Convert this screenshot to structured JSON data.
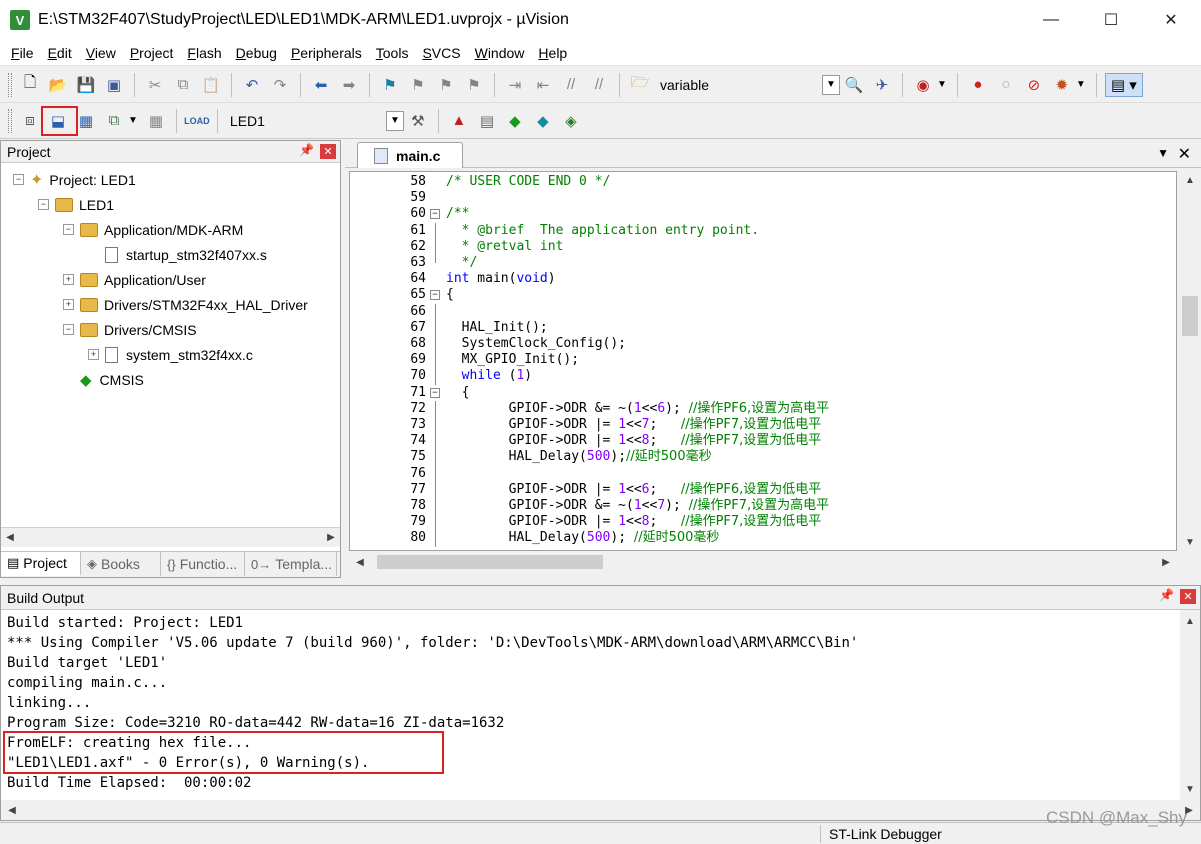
{
  "window": {
    "title": "E:\\STM32F407\\StudyProject\\LED\\LED1\\MDK-ARM\\LED1.uvprojx - µVision",
    "app_icon": "V",
    "minimize": "—",
    "maximize": "☐",
    "close": "✕"
  },
  "menu": [
    {
      "first": "F",
      "rest": "ile"
    },
    {
      "first": "E",
      "rest": "dit"
    },
    {
      "first": "V",
      "rest": "iew"
    },
    {
      "first": "P",
      "rest": "roject"
    },
    {
      "first": "F",
      "rest": "lash",
      "pre": ""
    },
    {
      "first": "D",
      "rest": "ebug"
    },
    {
      "first": "P",
      "rest": "eripherals"
    },
    {
      "first": "T",
      "rest": "ools"
    },
    {
      "first": "S",
      "rest": "VCS"
    },
    {
      "first": "W",
      "rest": "indow"
    },
    {
      "first": "H",
      "rest": "elp"
    }
  ],
  "toolbar": {
    "find_text": "variable",
    "target": "LED1",
    "icons": {
      "new": "new-file-icon",
      "open": "open-folder-icon",
      "save": "save-icon",
      "save_all": "save-all-icon",
      "cut": "cut-icon",
      "copy": "copy-icon",
      "paste": "paste-icon",
      "undo": "undo-icon",
      "redo": "redo-icon",
      "back": "nav-back-icon",
      "forward": "nav-forward-icon",
      "bookmark": "bookmark-icon",
      "build": "build-icon",
      "rebuild": "rebuild-icon",
      "download": "download-load-icon"
    }
  },
  "project_panel": {
    "title": "Project",
    "tree": [
      {
        "label": "Project: LED1",
        "level": 0,
        "exp": "−",
        "kind": "project"
      },
      {
        "label": "LED1",
        "level": 1,
        "exp": "−",
        "kind": "target"
      },
      {
        "label": "Application/MDK-ARM",
        "level": 2,
        "exp": "−",
        "kind": "folder"
      },
      {
        "label": "startup_stm32f407xx.s",
        "level": 3,
        "exp": "",
        "kind": "file"
      },
      {
        "label": "Application/User",
        "level": 2,
        "exp": "+",
        "kind": "folder"
      },
      {
        "label": "Drivers/STM32F4xx_HAL_Driver",
        "level": 2,
        "exp": "+",
        "kind": "folder"
      },
      {
        "label": "Drivers/CMSIS",
        "level": 2,
        "exp": "−",
        "kind": "folder"
      },
      {
        "label": "system_stm32f4xx.c",
        "level": 3,
        "exp": "+",
        "kind": "file"
      },
      {
        "label": "CMSIS",
        "level": 2,
        "exp": "",
        "kind": "cmsis"
      }
    ],
    "tabs": [
      {
        "label": "Project",
        "icon": "▤"
      },
      {
        "label": "Books",
        "icon": "◈"
      },
      {
        "label": "Functio...",
        "icon": "{}"
      },
      {
        "label": "Templa...",
        "icon": "0→"
      }
    ]
  },
  "editor": {
    "tab": "main.c",
    "lines": [
      {
        "n": "58",
        "fold": "",
        "parts": [
          {
            "c": "c-comment",
            "t": "/* USER CODE END 0 */"
          }
        ]
      },
      {
        "n": "59",
        "fold": "",
        "parts": []
      },
      {
        "n": "60",
        "fold": "−",
        "parts": [
          {
            "c": "c-comment",
            "t": "/**"
          }
        ]
      },
      {
        "n": "61",
        "fold": "|",
        "parts": [
          {
            "c": "c-comment",
            "t": "  * @brief  The application entry point."
          }
        ]
      },
      {
        "n": "62",
        "fold": "|",
        "parts": [
          {
            "c": "c-comment",
            "t": "  * @retval int"
          }
        ]
      },
      {
        "n": "63",
        "fold": "L",
        "parts": [
          {
            "c": "c-comment",
            "t": "  */"
          }
        ]
      },
      {
        "n": "64",
        "fold": "",
        "parts": [
          {
            "c": "c-kw",
            "t": "int"
          },
          {
            "c": "",
            "t": " main("
          },
          {
            "c": "c-kw",
            "t": "void"
          },
          {
            "c": "",
            "t": ")"
          }
        ]
      },
      {
        "n": "65",
        "fold": "−",
        "parts": [
          {
            "c": "",
            "t": "{"
          }
        ]
      },
      {
        "n": "66",
        "fold": "|",
        "parts": []
      },
      {
        "n": "67",
        "fold": "|",
        "parts": [
          {
            "c": "",
            "t": "  HAL_Init();"
          }
        ]
      },
      {
        "n": "68",
        "fold": "|",
        "parts": [
          {
            "c": "",
            "t": "  SystemClock_Config();"
          }
        ]
      },
      {
        "n": "69",
        "fold": "|",
        "parts": [
          {
            "c": "",
            "t": "  MX_GPIO_Init();"
          }
        ]
      },
      {
        "n": "70",
        "fold": "|",
        "parts": [
          {
            "c": "",
            "t": "  "
          },
          {
            "c": "c-kw",
            "t": "while"
          },
          {
            "c": "",
            "t": " ("
          },
          {
            "c": "c-num",
            "t": "1"
          },
          {
            "c": "",
            "t": ")"
          }
        ]
      },
      {
        "n": "71",
        "fold": "−",
        "parts": [
          {
            "c": "",
            "t": "  {"
          }
        ]
      },
      {
        "n": "72",
        "fold": "|",
        "parts": [
          {
            "c": "",
            "t": "        GPIOF->ODR &= ~("
          },
          {
            "c": "c-num",
            "t": "1"
          },
          {
            "c": "",
            "t": "<<"
          },
          {
            "c": "c-num",
            "t": "6"
          },
          {
            "c": "",
            "t": "); "
          },
          {
            "c": "c-cn",
            "t": "//操作PF6,设置为高电平"
          }
        ]
      },
      {
        "n": "73",
        "fold": "|",
        "parts": [
          {
            "c": "",
            "t": "        GPIOF->ODR |= "
          },
          {
            "c": "c-num",
            "t": "1"
          },
          {
            "c": "",
            "t": "<<"
          },
          {
            "c": "c-num",
            "t": "7"
          },
          {
            "c": "",
            "t": ";   "
          },
          {
            "c": "c-cn",
            "t": "//操作PF7,设置为低电平"
          }
        ]
      },
      {
        "n": "74",
        "fold": "|",
        "parts": [
          {
            "c": "",
            "t": "        GPIOF->ODR |= "
          },
          {
            "c": "c-num",
            "t": "1"
          },
          {
            "c": "",
            "t": "<<"
          },
          {
            "c": "c-num",
            "t": "8"
          },
          {
            "c": "",
            "t": ";   "
          },
          {
            "c": "c-cn",
            "t": "//操作PF7,设置为低电平"
          }
        ]
      },
      {
        "n": "75",
        "fold": "|",
        "parts": [
          {
            "c": "",
            "t": "        HAL_Delay("
          },
          {
            "c": "c-num",
            "t": "500"
          },
          {
            "c": "",
            "t": ");"
          },
          {
            "c": "c-cn",
            "t": "//延时500毫秒"
          }
        ]
      },
      {
        "n": "76",
        "fold": "|",
        "parts": []
      },
      {
        "n": "77",
        "fold": "|",
        "parts": [
          {
            "c": "",
            "t": "        GPIOF->ODR |= "
          },
          {
            "c": "c-num",
            "t": "1"
          },
          {
            "c": "",
            "t": "<<"
          },
          {
            "c": "c-num",
            "t": "6"
          },
          {
            "c": "",
            "t": ";   "
          },
          {
            "c": "c-cn",
            "t": "//操作PF6,设置为低电平"
          }
        ]
      },
      {
        "n": "78",
        "fold": "|",
        "parts": [
          {
            "c": "",
            "t": "        GPIOF->ODR &= ~("
          },
          {
            "c": "c-num",
            "t": "1"
          },
          {
            "c": "",
            "t": "<<"
          },
          {
            "c": "c-num",
            "t": "7"
          },
          {
            "c": "",
            "t": "); "
          },
          {
            "c": "c-cn",
            "t": "//操作PF7,设置为高电平"
          }
        ]
      },
      {
        "n": "79",
        "fold": "|",
        "parts": [
          {
            "c": "",
            "t": "        GPIOF->ODR |= "
          },
          {
            "c": "c-num",
            "t": "1"
          },
          {
            "c": "",
            "t": "<<"
          },
          {
            "c": "c-num",
            "t": "8"
          },
          {
            "c": "",
            "t": ";   "
          },
          {
            "c": "c-cn",
            "t": "//操作PF7,设置为低电平"
          }
        ]
      },
      {
        "n": "80",
        "fold": "|",
        "parts": [
          {
            "c": "",
            "t": "        HAL_Delay("
          },
          {
            "c": "c-num",
            "t": "500"
          },
          {
            "c": "",
            "t": "); "
          },
          {
            "c": "c-cn",
            "t": "//延时500毫秒"
          }
        ]
      }
    ]
  },
  "build_output": {
    "title": "Build Output",
    "lines": [
      "Build started: Project: LED1",
      "*** Using Compiler 'V5.06 update 7 (build 960)', folder: 'D:\\DevTools\\MDK-ARM\\download\\ARM\\ARMCC\\Bin'",
      "Build target 'LED1'",
      "compiling main.c...",
      "linking...",
      "Program Size: Code=3210 RO-data=442 RW-data=16 ZI-data=1632",
      "FromELF: creating hex file...",
      "\"LED1\\LED1.axf\" - 0 Error(s), 0 Warning(s).",
      "Build Time Elapsed:  00:00:02"
    ]
  },
  "status": {
    "debugger": "ST-Link Debugger",
    "watermark": "CSDN @Max_Shy"
  },
  "colors": {
    "highlight_box": "#e02020",
    "comment": "#008000",
    "keyword": "#0000ff",
    "number": "#8000ff"
  }
}
